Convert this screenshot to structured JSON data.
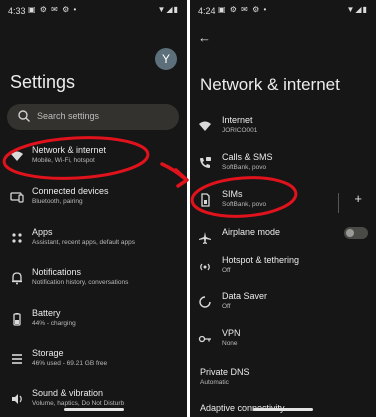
{
  "left": {
    "status": {
      "time": "4:33",
      "icons": "▣ ⚙ ✉ ⚙ •",
      "right_icons": "▼◢▮"
    },
    "avatar_letter": "Y",
    "title": "Settings",
    "search_placeholder": "Search settings",
    "items": [
      {
        "title": "Network & internet",
        "sub": "Mobile, Wi-Fi, hotspot",
        "icon": "wifi-icon"
      },
      {
        "title": "Connected devices",
        "sub": "Bluetooth, pairing",
        "icon": "connected-devices-icon"
      },
      {
        "title": "Apps",
        "sub": "Assistant, recent apps, default apps",
        "icon": "apps-icon"
      },
      {
        "title": "Notifications",
        "sub": "Notification history, conversations",
        "icon": "bell-icon"
      },
      {
        "title": "Battery",
        "sub": "44% - charging",
        "icon": "battery-icon"
      },
      {
        "title": "Storage",
        "sub": "46% used - 69.21 GB free",
        "icon": "storage-icon"
      },
      {
        "title": "Sound & vibration",
        "sub": "Volume, haptics, Do Not Disturb",
        "icon": "speaker-icon"
      }
    ]
  },
  "right": {
    "status": {
      "time": "4:24",
      "icons": "▣ ⚙ ✉ ⚙ •",
      "right_icons": "▼◢▮"
    },
    "title": "Network & internet",
    "items": [
      {
        "title": "Internet",
        "sub": "JORICO001",
        "icon": "wifi-icon"
      },
      {
        "title": "Calls & SMS",
        "sub": "SoftBank, povo",
        "icon": "calls-sms-icon"
      },
      {
        "title": "SIMs",
        "sub": "SoftBank, povo",
        "icon": "sim-icon"
      },
      {
        "title": "Airplane mode",
        "sub": "",
        "icon": "airplane-icon"
      },
      {
        "title": "Hotspot & tethering",
        "sub": "Off",
        "icon": "hotspot-icon"
      },
      {
        "title": "Data Saver",
        "sub": "Off",
        "icon": "data-saver-icon"
      },
      {
        "title": "VPN",
        "sub": "None",
        "icon": "vpn-icon"
      },
      {
        "title": "Private DNS",
        "sub": "Automatic",
        "icon": ""
      },
      {
        "title": "Adaptive connectivity",
        "sub": "",
        "icon": ""
      }
    ],
    "airplane_mode_on": false
  },
  "colors": {
    "background": "#161616",
    "search_bg": "#33322f",
    "annotation": "#e0121b"
  }
}
